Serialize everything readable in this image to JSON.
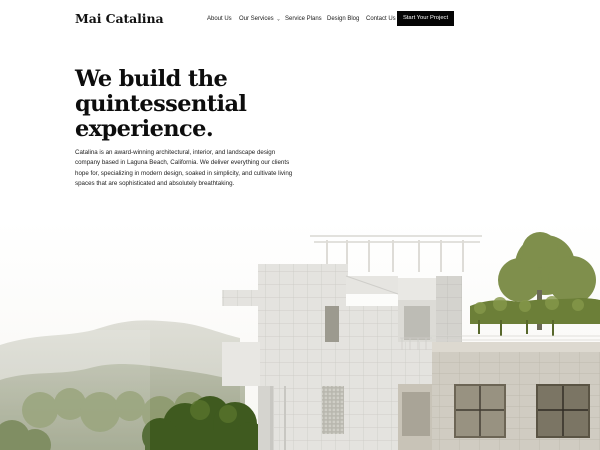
{
  "site": {
    "brand": "Mai Catalina"
  },
  "nav": {
    "items": [
      {
        "label": "About Us"
      },
      {
        "label": "Our Services"
      },
      {
        "label": "Service Plans"
      },
      {
        "label": "Design Blog"
      },
      {
        "label": "Contact Us"
      }
    ],
    "services_dropdown_icon": "chevron-down-icon",
    "cta_label": "Start Your Project"
  },
  "hero": {
    "title_lines": [
      "We build the",
      "quintessential",
      "experience."
    ],
    "copy_lines": [
      "Catalina is an award-winning architectural, interior, and landscape design",
      "company based in Laguna Beach, California. We deliver everything our clients",
      "hope for, specializing in modern design, soaked in simplicity, and cultivate living",
      "spaces that are sophisticated and absolutely breathtaking."
    ]
  },
  "colors": {
    "cta_background": "#050505",
    "cta_text": "#ffffff",
    "text": "#111111",
    "background": "#ffffff"
  }
}
